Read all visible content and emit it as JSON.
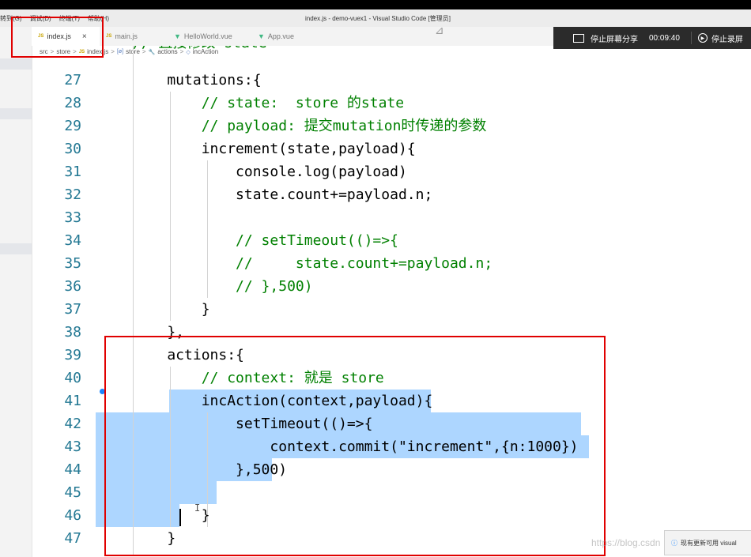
{
  "window": {
    "title": "index.js - demo-vuex1 - Visual Studio Code [管理员]",
    "menu": [
      "转到(G)",
      "调试(D)",
      "终端(T)",
      "帮助(H)"
    ]
  },
  "tabs": [
    {
      "icon": "JS",
      "label": "index.js",
      "close": "×"
    },
    {
      "icon": "JS",
      "label": "main.js"
    },
    {
      "icon": "▼",
      "label": "HelloWorld.vue"
    },
    {
      "icon": "▼",
      "label": "App.vue"
    }
  ],
  "breadcrumb": {
    "items": [
      "src",
      "store",
      "index.js",
      "store",
      "actions",
      "incAction"
    ],
    "js_icon": "JS",
    "separator": ">"
  },
  "recording": {
    "stop_share_label": "停止屏幕分享",
    "timer": "00:09:40",
    "stop_record_label": "停止录屏"
  },
  "editor": {
    "lines": [
      {
        "n": "27",
        "text": "    mutations:{"
      },
      {
        "n": "28",
        "text": "        // state:  store 的state"
      },
      {
        "n": "29",
        "text": "        // payload: 提交mutation时传递的参数"
      },
      {
        "n": "30",
        "text": "        increment(state,payload){"
      },
      {
        "n": "31",
        "text": "            console.log(payload)"
      },
      {
        "n": "32",
        "text": "            state.count+=payload.n;"
      },
      {
        "n": "33",
        "text": ""
      },
      {
        "n": "34",
        "text": "            // setTimeout(()=>{"
      },
      {
        "n": "35",
        "text": "            //     state.count+=payload.n;"
      },
      {
        "n": "36",
        "text": "            // },500)"
      },
      {
        "n": "37",
        "text": "        }"
      },
      {
        "n": "38",
        "text": "    },"
      },
      {
        "n": "39",
        "text": "    actions:{"
      },
      {
        "n": "40",
        "text": "        // context: 就是 store"
      },
      {
        "n": "41",
        "text": "        incAction(context,payload){"
      },
      {
        "n": "42",
        "text": "            setTimeout(()=>{"
      },
      {
        "n": "43",
        "text": "                context.commit(\"increment\",{n:1000})"
      },
      {
        "n": "44",
        "text": "            },500)"
      },
      {
        "n": "45",
        "text": ""
      },
      {
        "n": "46",
        "text": "        }"
      },
      {
        "n": "47",
        "text": "    }"
      }
    ],
    "partial_top_line": "// 直接修改 state"
  },
  "notification": {
    "text": "现有更新可用 visual"
  },
  "watermark": "https://blog.csdn",
  "colors": {
    "selection": "#add6ff",
    "line_number": "#237893",
    "comment": "#008000",
    "string": "#a31515",
    "number": "#098658",
    "annotation_red": "#e00000"
  }
}
